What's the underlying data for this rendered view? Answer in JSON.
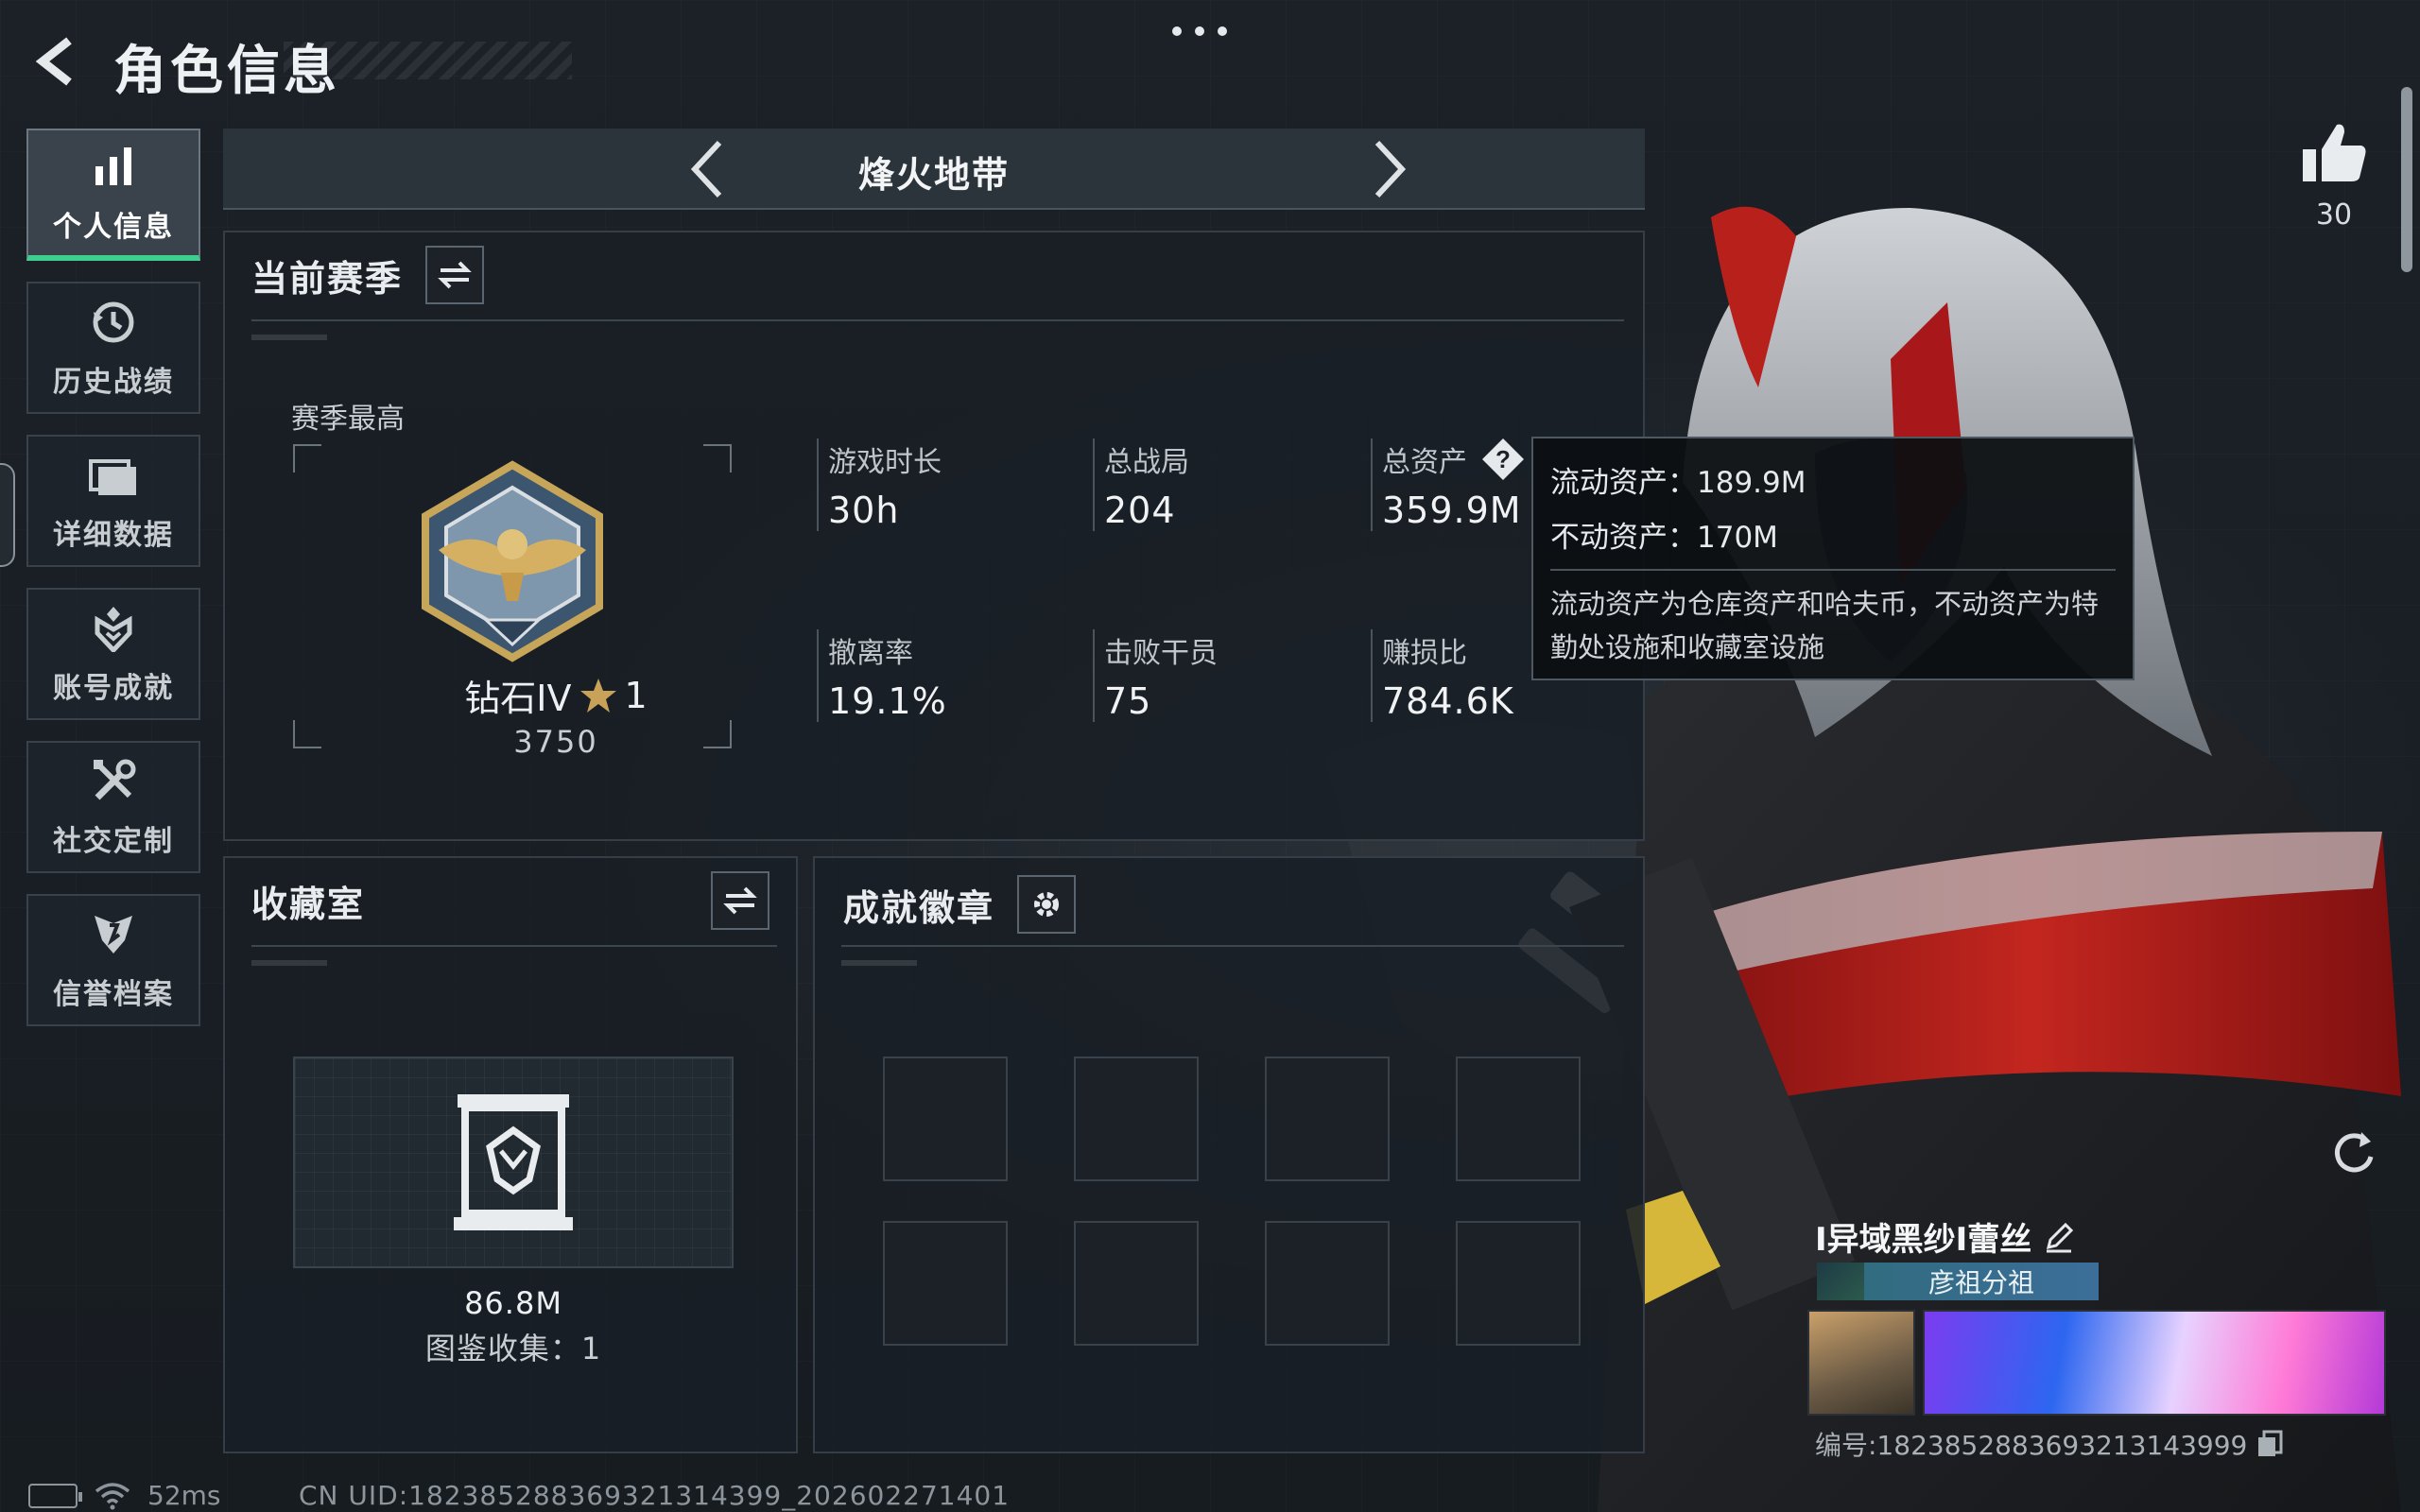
{
  "header": {
    "title": "角色信息"
  },
  "sidebar": {
    "items": [
      {
        "label": "个人信息",
        "icon": "bar-chart-icon",
        "active": true
      },
      {
        "label": "历史战绩",
        "icon": "history-icon",
        "active": false
      },
      {
        "label": "详细数据",
        "icon": "folder-icon",
        "active": false
      },
      {
        "label": "账号成就",
        "icon": "medal-icon",
        "active": false
      },
      {
        "label": "社交定制",
        "icon": "tools-icon",
        "active": false
      },
      {
        "label": "信誉档案",
        "icon": "shield-icon",
        "active": false
      }
    ]
  },
  "mode": {
    "title": "烽火地带"
  },
  "season": {
    "title": "当前赛季",
    "best_label": "赛季最高",
    "rank_name": "钻石IV",
    "rank_stars": "1",
    "rank_score": "3750",
    "stats": [
      {
        "label": "游戏时长",
        "value": "30h"
      },
      {
        "label": "总战局",
        "value": "204"
      },
      {
        "label": "总资产",
        "value": "359.9M"
      },
      {
        "label": "撤离率",
        "value": "19.1%"
      },
      {
        "label": "击败干员",
        "value": "75"
      },
      {
        "label": "赚损比",
        "value": "784.6K"
      }
    ]
  },
  "tooltip": {
    "liquid": "流动资产：189.9M",
    "fixed": "不动资产：170M",
    "description": "流动资产为仓库资产和哈夫币，不动资产为特勤处设施和收藏室设施"
  },
  "collection": {
    "title": "收藏室",
    "value": "86.8M",
    "count": "图鉴收集：1"
  },
  "achievements": {
    "title": "成就徽章"
  },
  "profile": {
    "likes": "30",
    "name": "I异域黑纱I蕾丝",
    "title_tag": "彦祖分祖",
    "card_id": "编号:1823852883693213143999"
  },
  "footer": {
    "ping": "52ms",
    "uid": "CN UID:182385288369321314399_202602271401"
  },
  "colors": {
    "accent_green": "#3ecf8e",
    "panel_bg": "#191f25"
  }
}
